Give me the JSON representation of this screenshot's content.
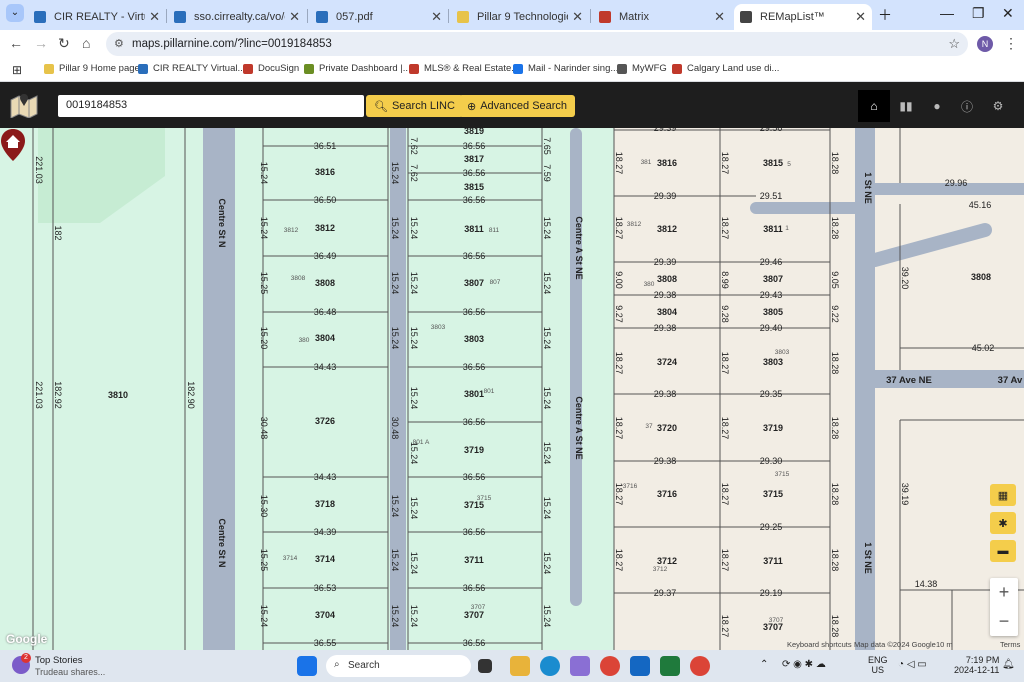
{
  "tabs": [
    {
      "title": "CIR REALTY - Virtual Offic",
      "color": "#2a6ebb"
    },
    {
      "title": "sso.cirrealty.ca/vo/cir-inte",
      "color": "#2a6ebb"
    },
    {
      "title": "057.pdf",
      "color": "#2a6ebb"
    },
    {
      "title": "Pillar 9 Technologies - Allo",
      "color": "#e7c34a"
    },
    {
      "title": "Matrix",
      "color": "#c0392b"
    },
    {
      "title": "REMapList™",
      "color": "#444444"
    }
  ],
  "url": "maps.pillarnine.com/?linc=0019184853",
  "profile_initial": "N",
  "bookmarks": [
    {
      "label": "Pillar 9 Home page",
      "color": "#e7c34a"
    },
    {
      "label": "CIR REALTY Virtual...",
      "color": "#2a6ebb"
    },
    {
      "label": "DocuSign",
      "color": "#c0392b"
    },
    {
      "label": "Private Dashboard |...",
      "color": "#6b8e23"
    },
    {
      "label": "MLS® & Real Estate...",
      "color": "#c0392b"
    },
    {
      "label": "Mail - Narinder sing...",
      "color": "#1a73e8"
    },
    {
      "label": "MyWFG",
      "color": "#555555"
    },
    {
      "label": "Calgary Land use di...",
      "color": "#c0392b"
    }
  ],
  "app": {
    "search_value": "0019184853",
    "search_linc_label": "Search  LINC",
    "advanced_search_label": "Advanced Search"
  },
  "map": {
    "streets": {
      "centre_st_n_1": "Centre St N",
      "centre_st_n_2": "Centre St N",
      "centre_a_st_ne_1": "Centre A St NE",
      "centre_a_st_ne_2": "Centre A St NE",
      "first_st_ne_1": "1 St NE",
      "first_st_ne_2": "1 St NE",
      "ave37_1": "37 Ave NE",
      "ave37_2": "37 Av"
    },
    "big_lot": "3810",
    "left_labels": [
      "221.03",
      "182",
      "221.03",
      "182.92",
      "182.90"
    ],
    "col1_addr": [
      "3816",
      "3812",
      "3808",
      "3804",
      "3726",
      "3718",
      "3714",
      "3704"
    ],
    "col1_small": [
      "3812",
      "3808",
      "380",
      "3714"
    ],
    "col1_depth": [
      "36.51",
      "36.50",
      "36.49",
      "36.48",
      "34.43",
      "34.43",
      "34.39",
      "36.53",
      "36.55"
    ],
    "col1_front": [
      "15.24",
      "15.24",
      "15.25",
      "15.20",
      "30.48",
      "15.30",
      "15.25",
      "15.24"
    ],
    "col1_right_front": [
      "15.24",
      "15.24",
      "15.24",
      "15.24",
      "30.48",
      "15.24",
      "15.24",
      "15.24"
    ],
    "col2_addr": [
      "3819",
      "3817",
      "3815",
      "3811",
      "3807",
      "3803",
      "3801",
      "3719",
      "3715",
      "3711",
      "3707"
    ],
    "col2_small": [
      "811",
      "807",
      "3803",
      "801",
      "801 A",
      "3715",
      "3707"
    ],
    "col2_depth": [
      "36.56",
      "36.56",
      "36.56",
      "36.56",
      "36.56",
      "36.56",
      "36.56",
      "36.56",
      "36.56",
      "36.56",
      "36.56",
      "36.56"
    ],
    "col2_front_left": [
      "7.62",
      "7.62",
      "15.24",
      "15.24",
      "15.24",
      "15.24",
      "15.24",
      "15.24",
      "15.24",
      "15.24"
    ],
    "col2_front_right": [
      "7.65",
      "7.59",
      "15.24",
      "15.24",
      "15.24",
      "15.24",
      "15.24",
      "15.24",
      "15.24",
      "15.24"
    ],
    "col3_addr": [
      "3816",
      "3812",
      "3808",
      "3804",
      "3724",
      "3720",
      "3716",
      "3712"
    ],
    "col3_small": [
      "381",
      "3812",
      "380",
      "37",
      "3716",
      "3712"
    ],
    "col3_depth": [
      "29.39",
      "29.39",
      "29.39",
      "29.38",
      "29.38",
      "29.38",
      "29.38",
      "29.37"
    ],
    "col3_front": [
      "18.27",
      "18.27",
      "9.00",
      "9.27",
      "18.27",
      "18.27",
      "18.27",
      "18.27"
    ],
    "col4_addr": [
      "3815",
      "3811",
      "3807",
      "3805",
      "3803",
      "3719",
      "3715",
      "3711",
      "3707"
    ],
    "col4_small": [
      "5",
      "1",
      "3803",
      "3715",
      "3707"
    ],
    "col4_depth": [
      "29.56",
      "29.51",
      "29.46",
      "29.43",
      "29.40",
      "29.35",
      "29.30",
      "29.25",
      "29.19"
    ],
    "col4_front_left": [
      "18.27",
      "18.27",
      "8.99",
      "9.28",
      "18.27",
      "18.27",
      "18.27",
      "18.27",
      "18.27"
    ],
    "col4_front_right": [
      "18.28",
      "18.28",
      "9.05",
      "9.22",
      "18.28",
      "18.28",
      "18.28",
      "18.28",
      "18.28"
    ],
    "east": {
      "a": "29.96",
      "b": "45.16",
      "lot": "3808",
      "c": "39.20",
      "d": "45.02",
      "e": "39.19",
      "f": "14.38"
    },
    "google_logo": "Google",
    "footer": {
      "keyboard": "Keyboard shortcuts",
      "data": "Map data ©2024 Google",
      "scale": "10 m",
      "terms": "Terms"
    }
  },
  "taskbar": {
    "news_title": "Top Stories",
    "news_sub": "Trudeau shares...",
    "news_badge": "2",
    "search_placeholder": "Search",
    "lang": "ENG",
    "region": "US",
    "time": "7:19 PM",
    "date": "2024-12-11"
  },
  "colors": {
    "app_bar": "#1e1e1e",
    "accent": "#f4cd4b",
    "map_green": "#d7f4e4",
    "map_beige": "#f2ede4",
    "road": "#a8b4c6",
    "pin": "#8b1a1a"
  }
}
